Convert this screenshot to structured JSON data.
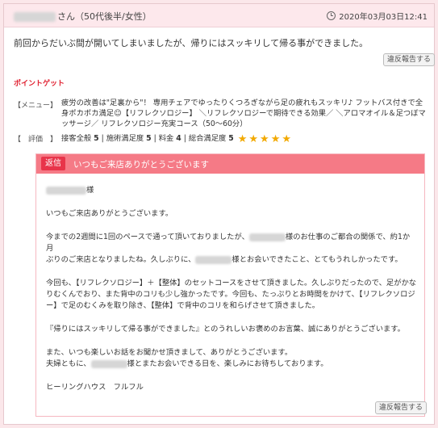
{
  "review": {
    "reviewer_suffix": "さん（50代後半/女性）",
    "datetime": "2020年03月03日12:41",
    "text": "前回からだいぶ間が開いてしまいましたが、帰りにはスッキリして帰る事ができました。",
    "report_label": "違反報告する",
    "point_label": "ポイントゲット",
    "menu_label": "【メニュー】",
    "menu_text": "疲労の改善は\"足裏から\"！ 専用チェアでゆったりくつろぎながら足の疲れもスッキリ♪ フットバス付きで全身ポカポカ満足☺【リフレクソロジー】 ＼リフレクソロジーで期待できる効果／ ＼アロマオイル＆足つぼマッサージ／ リフレクソロジー充実コース（50～60分）",
    "eval_label": "【　評価　】",
    "scores": {
      "service_label": "接客全般",
      "service_value": "5",
      "facility_label": "施術満足度",
      "facility_value": "5",
      "price_label": "料金",
      "price_value": "4",
      "overall_label": "総合満足度",
      "overall_value": "5",
      "stars": 5
    }
  },
  "reply": {
    "badge": "返信",
    "title": "いつもご来店ありがとうございます",
    "honorific": "様",
    "line1": "いつもご来店ありがとうございます。",
    "p2a": "今までの2週間に1回のペースで通って頂いておりましたが、",
    "p2b": "様のお仕事のご都合の関係で、約1か月",
    "p2c": "ぶりのご来店となりましたね。久しぶりに、",
    "p2d": "様とお会いできたこと、とてもうれしかったです。",
    "p3": "今回も、【リフレクソロジー】＋【整体】のセットコースをさせて頂きました。久しぶりだったので、足がかなりむくんでおり、また背中のコリも少し強かったです。今回も、たっぷりとお時間をかけて、【リフレクソロジー】で足のむくみを取り除き、【整体】で背中のコリを和らげさせて頂きました。",
    "p4": "『帰りにはスッキリして帰る事ができました』とのうれしいお褒めのお言葉、誠にありがとうございます。",
    "p5a": "また、いつも楽しいお話をお聞かせ頂きまして、ありがとうございます。",
    "p5b": "夫婦ともに、",
    "p5c": "様とまたお会いできる日を、楽しみにお待ちしております。",
    "signature": "ヒーリングハウス　フルフル",
    "report_label": "違反報告する"
  },
  "colors": {
    "page_bg": "#fbe7ea",
    "reply_header": "#f57a86",
    "reply_badge": "#e8344a",
    "point_label": "#e02030",
    "star": "#f2a900"
  }
}
